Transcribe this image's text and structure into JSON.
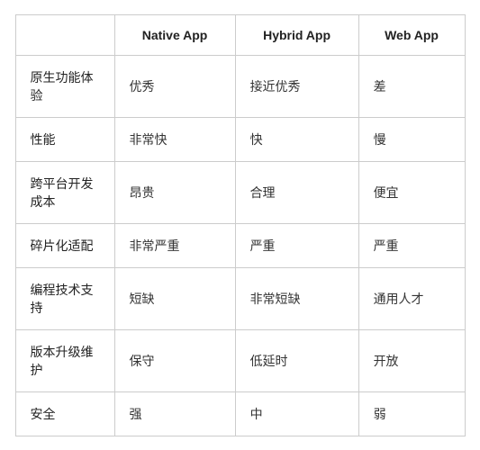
{
  "table": {
    "headers": [
      "",
      "Native App",
      "Hybrid App",
      "Web App"
    ],
    "rows": [
      {
        "feature": "原生功能体验",
        "native": "优秀",
        "hybrid": "接近优秀",
        "web": "差"
      },
      {
        "feature": "性能",
        "native": "非常快",
        "hybrid": "快",
        "web": "慢"
      },
      {
        "feature": "跨平台开发成本",
        "native": "昂贵",
        "hybrid": "合理",
        "web": "便宜"
      },
      {
        "feature": "碎片化适配",
        "native": "非常严重",
        "hybrid": "严重",
        "web": "严重"
      },
      {
        "feature": "编程技术支持",
        "native": "短缺",
        "hybrid": "非常短缺",
        "web": "通用人才"
      },
      {
        "feature": "版本升级维护",
        "native": "保守",
        "hybrid": "低延时",
        "web": "开放"
      },
      {
        "feature": "安全",
        "native": "强",
        "hybrid": "中",
        "web": "弱"
      }
    ]
  }
}
